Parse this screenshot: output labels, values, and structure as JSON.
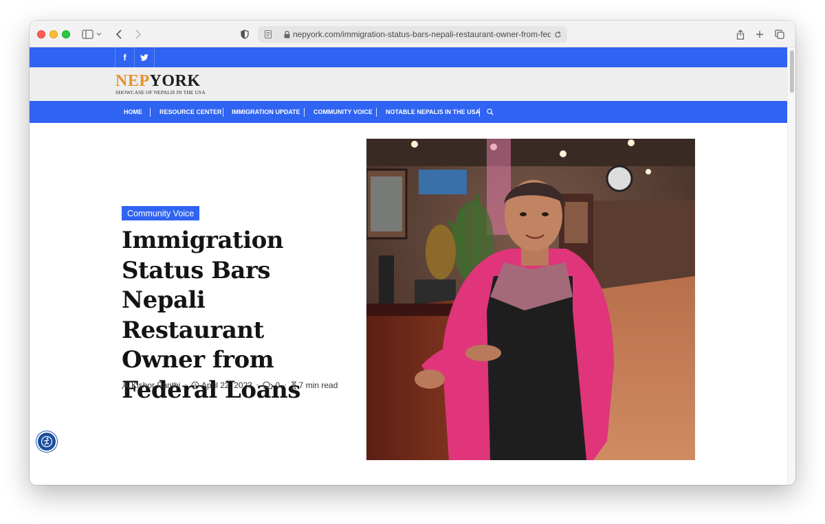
{
  "browser": {
    "url": "nepyork.com/immigration-status-bars-nepali-restaurant-owner-from-federal-lo"
  },
  "site": {
    "logo": {
      "part1": "NEP",
      "part2": "YORK",
      "tagline": "SHOWCASE OF NEPALIS IN THE USA"
    },
    "social": [
      {
        "icon": "facebook-icon",
        "glyph": "f"
      },
      {
        "icon": "twitter-icon"
      }
    ],
    "nav": {
      "items": [
        {
          "label": "HOME"
        },
        {
          "label": "RESOURCE CENTER"
        },
        {
          "label": "IMMIGRATION UPDATE"
        },
        {
          "label": "COMMUNITY VOICE"
        },
        {
          "label": "NOTABLE NEPALIS IN THE USA"
        }
      ],
      "search_icon": "search-icon"
    },
    "colors": {
      "brand_blue": "#2f63f2",
      "logo_orange": "#e8912d"
    }
  },
  "article": {
    "category": "Community Voice",
    "title": "Immigration Status Bars Nepali Restaurant Owner from Federal Loans",
    "author": "Kishor Panthi",
    "date": "April 22, 2023",
    "comments": "0",
    "read_time": "7 min read",
    "hero_image": "photo-of-woman-in-pink-cardigan-and-black-apron-in-restaurant"
  },
  "accessibility_widget": {
    "icon": "accessibility-icon"
  }
}
